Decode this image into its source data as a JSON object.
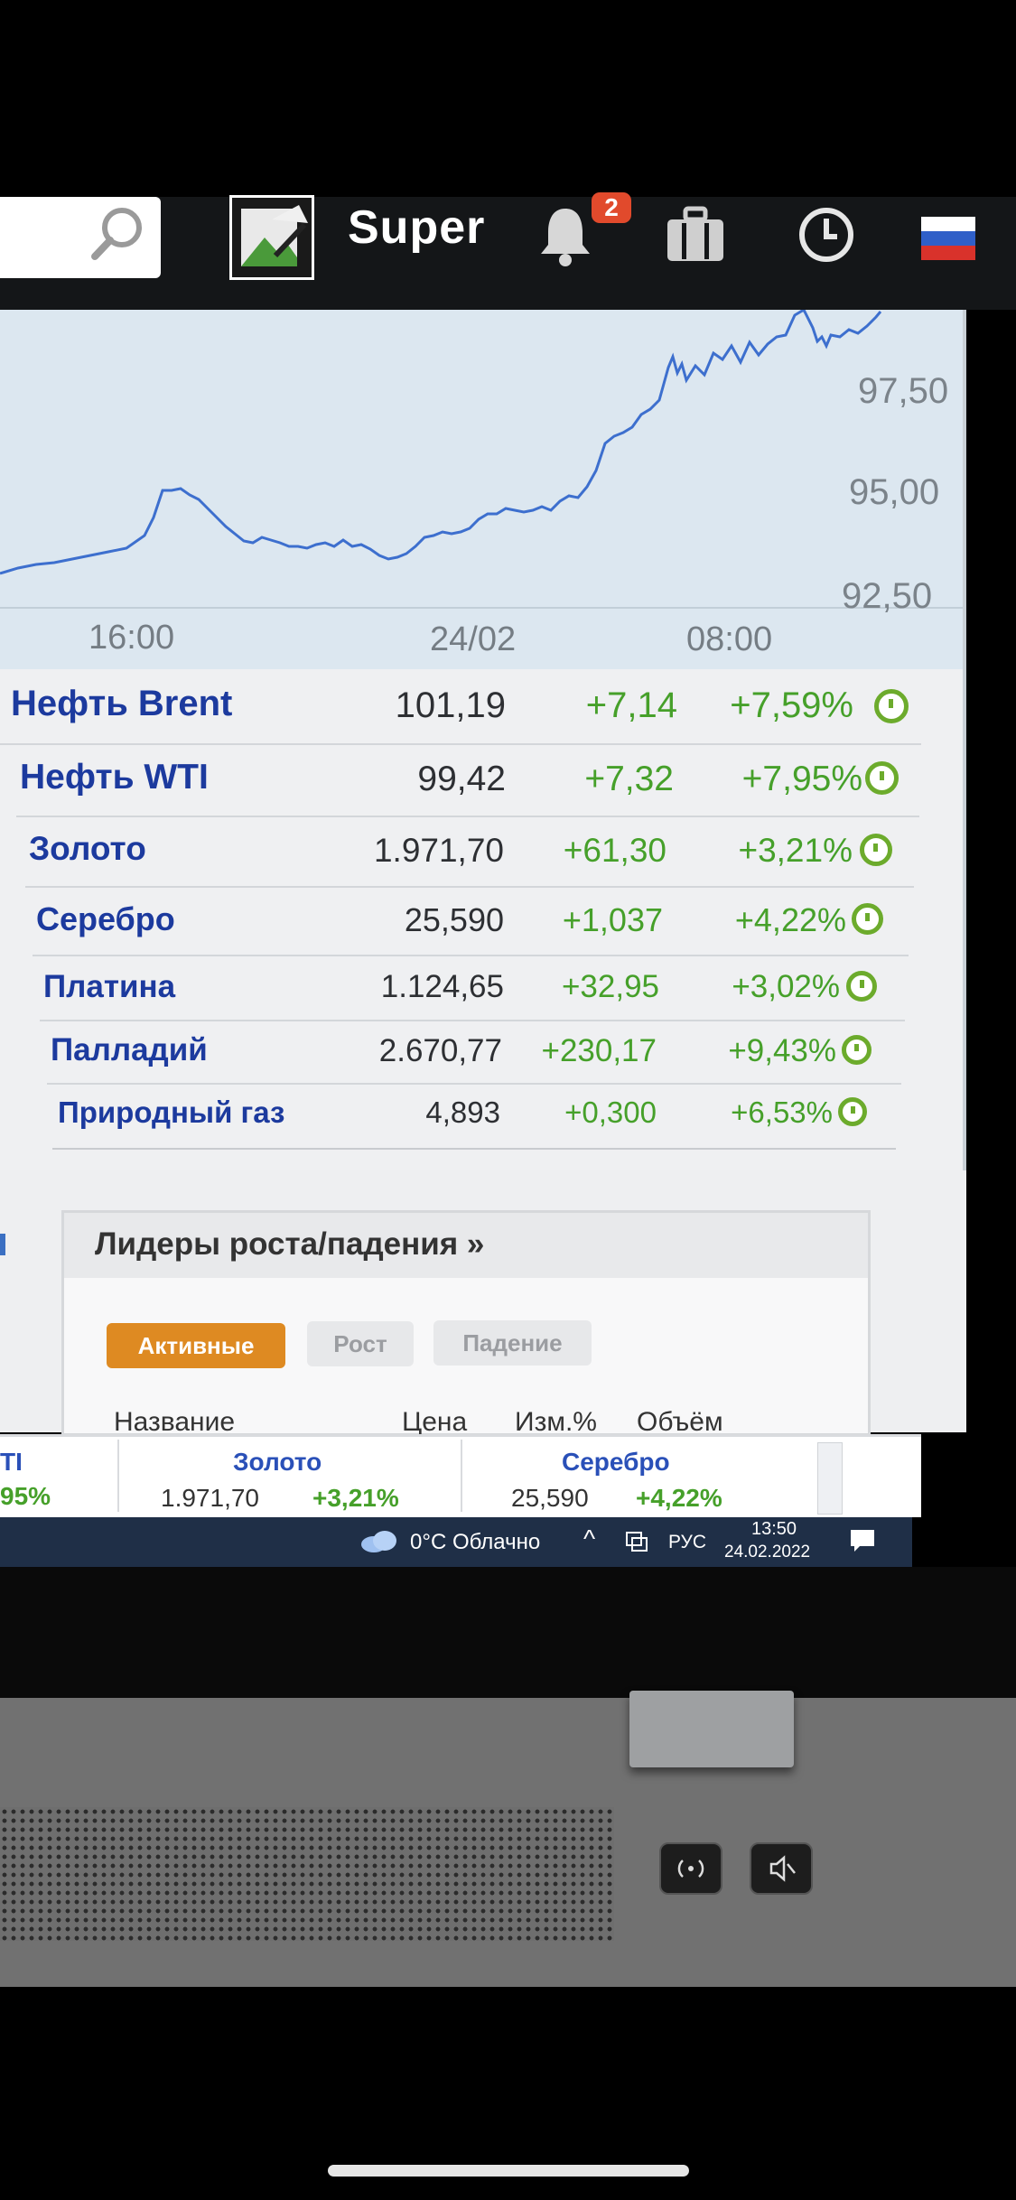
{
  "header": {
    "user_name": "Super",
    "notification_count": "2"
  },
  "chart": {
    "yticks": [
      "97,50",
      "95,00",
      "92,50"
    ],
    "xticks": [
      "16:00",
      "24/02",
      "08:00"
    ],
    "series_color": "#3d6fce"
  },
  "quotes": [
    {
      "name": "Нефть Brent",
      "price": "101,19",
      "change": "+7,14",
      "pct": "+7,59%"
    },
    {
      "name": "Нефть WTI",
      "price": "99,42",
      "change": "+7,32",
      "pct": "+7,95%"
    },
    {
      "name": "Золото",
      "price": "1.971,70",
      "change": "+61,30",
      "pct": "+3,21%"
    },
    {
      "name": "Серебро",
      "price": "25,590",
      "change": "+1,037",
      "pct": "+4,22%"
    },
    {
      "name": "Платина",
      "price": "1.124,65",
      "change": "+32,95",
      "pct": "+3,02%"
    },
    {
      "name": "Палладий",
      "price": "2.670,77",
      "change": "+230,17",
      "pct": "+9,43%"
    },
    {
      "name": "Природный газ",
      "price": "4,893",
      "change": "+0,300",
      "pct": "+6,53%"
    }
  ],
  "leaders": {
    "title": "Лидеры роста/падения »",
    "tabs": [
      "Активные",
      "Рост",
      "Падение"
    ],
    "columns": [
      "Название",
      "Цена",
      "Изм.%",
      "Объём"
    ]
  },
  "ticker": {
    "partial_left_name": "TI",
    "partial_left_pct": "95%",
    "items": [
      {
        "name": "Золото",
        "value": "1.971,70",
        "change": "+3,21%"
      },
      {
        "name": "Серебро",
        "value": "25,590",
        "change": "+4,22%"
      }
    ]
  },
  "taskbar": {
    "weather": "0°C Облачно",
    "language": "РУС",
    "time": "13:50",
    "date": "24.02.2022"
  },
  "colors": {
    "positive": "#46a02a",
    "instrument_name": "#1c3a9e",
    "active_tab": "#de8a22"
  }
}
